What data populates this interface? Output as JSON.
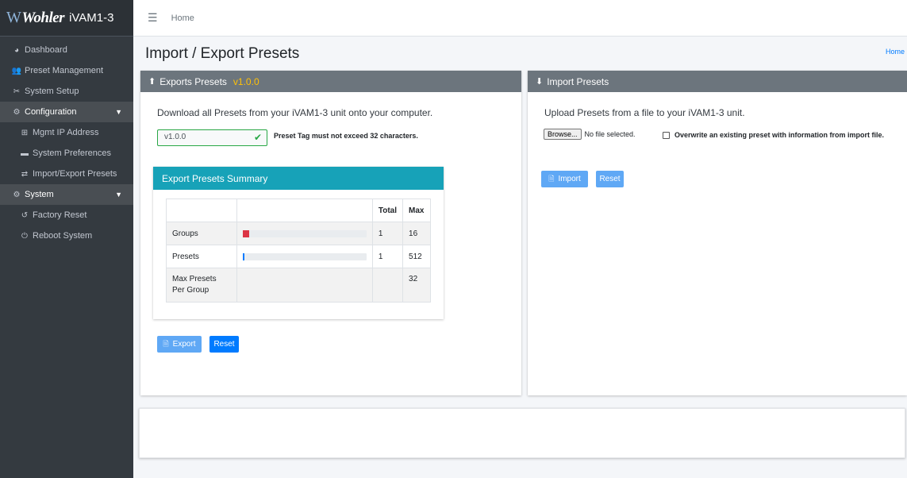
{
  "brand": {
    "logo": "Wohler",
    "product": "iVAM1-3"
  },
  "sidebar": {
    "items": [
      {
        "label": "Dashboard",
        "icon": "tachometer-icon"
      },
      {
        "label": "Preset Management",
        "icon": "users-icon"
      },
      {
        "label": "System Setup",
        "icon": "tools-icon"
      },
      {
        "label": "Configuration",
        "icon": "cog-icon"
      },
      {
        "label": "Mgmt IP Address",
        "icon": "network-icon"
      },
      {
        "label": "System Preferences",
        "icon": "keyboard-icon"
      },
      {
        "label": "Import/Export Presets",
        "icon": "exchange-icon"
      },
      {
        "label": "System",
        "icon": "cogs-icon"
      },
      {
        "label": "Factory Reset",
        "icon": "undo-icon"
      },
      {
        "label": "Reboot System",
        "icon": "power-icon"
      }
    ]
  },
  "topbar": {
    "home": "Home"
  },
  "page": {
    "title": "Import / Export Presets",
    "breadcrumb_home": "Home"
  },
  "export": {
    "title": "Exports Presets",
    "version": "v1.0.0",
    "description": "Download all Presets from your iVAM1-3 unit onto your computer.",
    "tag_value": "v1.0.0",
    "tag_note": "Preset Tag must not exceed 32 characters.",
    "summary": {
      "title": "Export Presets Summary",
      "headers": [
        "",
        "",
        "Total",
        "Max"
      ],
      "rows": [
        {
          "label": "Groups",
          "total": "1",
          "max": "16",
          "fill": 0.0625,
          "color": "#dc3545"
        },
        {
          "label": "Presets",
          "total": "1",
          "max": "512",
          "fill": 0.002,
          "color": "#007bff"
        },
        {
          "label": "Max Presets Per Group",
          "total": "",
          "max": "32"
        }
      ]
    },
    "export_button": "Export",
    "reset_button": "Reset"
  },
  "import": {
    "title": "Import Presets",
    "description": "Upload Presets from a file to your iVAM1-3 unit.",
    "browse_button": "Browse...",
    "file_status": "No file selected.",
    "overwrite_label": "Overwrite an existing preset with information from import file.",
    "import_button": "Import",
    "reset_button": "Reset"
  },
  "colors": {
    "sidebar": "#343a40",
    "card_header": "#6c757d",
    "summary_header": "#17a2b8",
    "accent": "#007bff",
    "version": "#ffc107",
    "valid": "#28a745"
  }
}
